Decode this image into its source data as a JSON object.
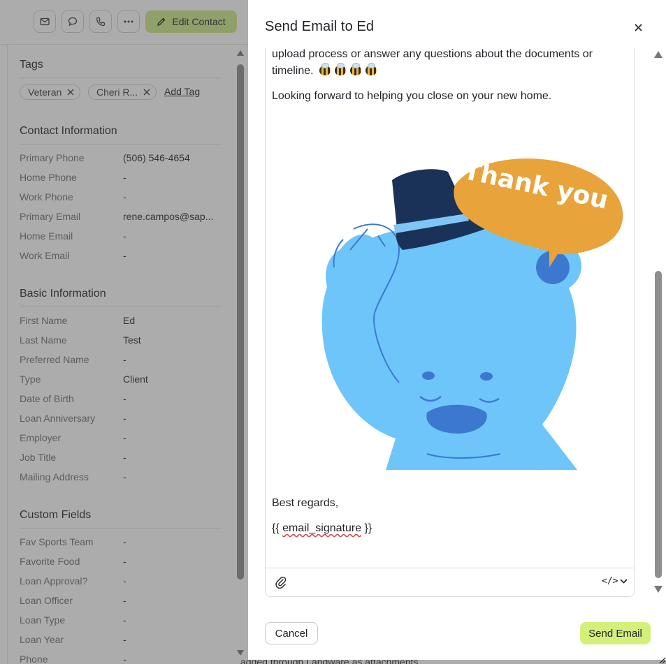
{
  "toolbar": {
    "icons": [
      "mail-icon",
      "chat-icon",
      "phone-icon",
      "more-icon"
    ],
    "edit_contact_label": "Edit Contact",
    "edit_color": "#cde987"
  },
  "sidebar": {
    "tags": {
      "title": "Tags",
      "items": [
        "Veteran",
        "Cheri R..."
      ],
      "add_label": "Add Tag"
    },
    "contact_information": {
      "title": "Contact Information",
      "rows": [
        {
          "label": "Primary Phone",
          "value": "(506) 546-4654"
        },
        {
          "label": "Home Phone",
          "value": "-"
        },
        {
          "label": "Work Phone",
          "value": "-"
        },
        {
          "label": "Primary Email",
          "value": "rene.campos@sap..."
        },
        {
          "label": "Home Email",
          "value": "-"
        },
        {
          "label": "Work Email",
          "value": "-"
        }
      ]
    },
    "basic_information": {
      "title": "Basic Information",
      "rows": [
        {
          "label": "First Name",
          "value": "Ed"
        },
        {
          "label": "Last Name",
          "value": "Test"
        },
        {
          "label": "Preferred Name",
          "value": "-"
        },
        {
          "label": "Type",
          "value": "Client"
        },
        {
          "label": "Date of Birth",
          "value": "-"
        },
        {
          "label": "Loan Anniversary",
          "value": "-"
        },
        {
          "label": "Employer",
          "value": "-"
        },
        {
          "label": "Job Title",
          "value": "-"
        },
        {
          "label": "Mailing Address",
          "value": "-"
        }
      ]
    },
    "custom_fields": {
      "title": "Custom Fields",
      "rows": [
        {
          "label": "Fav Sports Team",
          "value": "-"
        },
        {
          "label": "Favorite Food",
          "value": "-"
        },
        {
          "label": "Loan Approval?",
          "value": "-"
        },
        {
          "label": "Loan Officer",
          "value": "-"
        },
        {
          "label": "Loan Type",
          "value": "-"
        },
        {
          "label": "Loan Year",
          "value": "-"
        },
        {
          "label": "Phone",
          "value": "-"
        }
      ]
    }
  },
  "background_text": "added through Landware as attachments",
  "modal": {
    "title": "Send Email to Ed",
    "body": {
      "line1": "upload process or answer any questions about the documents or",
      "line2": "timeline.",
      "line3": "Looking forward to helping you close on your new home.",
      "image_caption": "Thank you",
      "closing": "Best regards,",
      "signature_open": "{{ ",
      "signature_var": "email_signature",
      "signature_close": " }}"
    },
    "toolbar": {
      "attach_icon": "paperclip-icon",
      "code_label": "</>"
    },
    "cancel_label": "Cancel",
    "send_label": "Send Email",
    "send_color": "#d4f07b"
  }
}
